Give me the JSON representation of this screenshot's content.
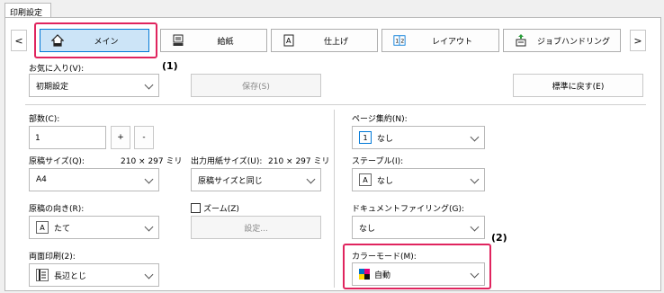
{
  "window": {
    "tab_title": "印刷設定"
  },
  "tabs": {
    "prev": "<",
    "next": ">",
    "items": [
      {
        "label": "メイン",
        "icon": "home-icon"
      },
      {
        "label": "給紙",
        "icon": "paper-tray-icon"
      },
      {
        "label": "仕上げ",
        "icon": "finishing-icon"
      },
      {
        "label": "レイアウト",
        "icon": "layout-icon"
      },
      {
        "label": "ジョブハンドリング",
        "icon": "job-handling-icon"
      }
    ]
  },
  "callouts": {
    "one": "(1)",
    "two": "(2)"
  },
  "favorites": {
    "label": "お気に入り(V):",
    "value": "初期設定",
    "save": "保存(S)",
    "reset": "標準に戻す(E)"
  },
  "copies": {
    "label": "部数(C):",
    "value": "1",
    "plus": "+",
    "minus": "-"
  },
  "original_size": {
    "label": "原稿サイズ(Q):",
    "dims": "210 × 297 ミリ",
    "value": "A4"
  },
  "output_size": {
    "label": "出力用紙サイズ(U):",
    "dims": "210 × 297 ミリ",
    "value": "原稿サイズと同じ"
  },
  "orientation": {
    "label": "原稿の向き(R):",
    "value": "たて"
  },
  "zoom": {
    "label": "ズーム(Z)",
    "settings": "設定..."
  },
  "duplex": {
    "label": "両面印刷(2):",
    "value": "長辺とじ"
  },
  "nup": {
    "label": "ページ集約(N):",
    "value": "なし",
    "icon_text": "1"
  },
  "staple": {
    "label": "ステープル(I):",
    "value": "なし",
    "icon_text": "A"
  },
  "doc_filing": {
    "label": "ドキュメントファイリング(G):",
    "value": "なし"
  },
  "color_mode": {
    "label": "カラーモード(M):",
    "value": "自動"
  },
  "colors": {
    "accent": "#0078d7",
    "highlight": "#e0245e"
  }
}
